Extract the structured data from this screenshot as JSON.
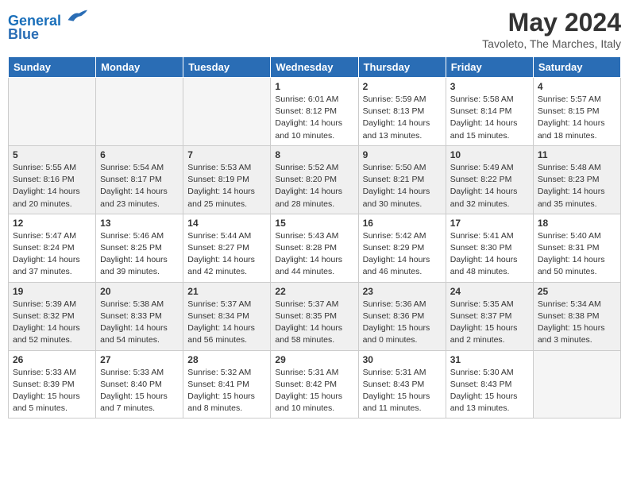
{
  "header": {
    "logo_line1": "General",
    "logo_line2": "Blue",
    "month": "May 2024",
    "location": "Tavoleto, The Marches, Italy"
  },
  "weekdays": [
    "Sunday",
    "Monday",
    "Tuesday",
    "Wednesday",
    "Thursday",
    "Friday",
    "Saturday"
  ],
  "weeks": [
    [
      {
        "day": "",
        "sunrise": "",
        "sunset": "",
        "daylight": ""
      },
      {
        "day": "",
        "sunrise": "",
        "sunset": "",
        "daylight": ""
      },
      {
        "day": "",
        "sunrise": "",
        "sunset": "",
        "daylight": ""
      },
      {
        "day": "1",
        "sunrise": "Sunrise: 6:01 AM",
        "sunset": "Sunset: 8:12 PM",
        "daylight": "Daylight: 14 hours and 10 minutes."
      },
      {
        "day": "2",
        "sunrise": "Sunrise: 5:59 AM",
        "sunset": "Sunset: 8:13 PM",
        "daylight": "Daylight: 14 hours and 13 minutes."
      },
      {
        "day": "3",
        "sunrise": "Sunrise: 5:58 AM",
        "sunset": "Sunset: 8:14 PM",
        "daylight": "Daylight: 14 hours and 15 minutes."
      },
      {
        "day": "4",
        "sunrise": "Sunrise: 5:57 AM",
        "sunset": "Sunset: 8:15 PM",
        "daylight": "Daylight: 14 hours and 18 minutes."
      }
    ],
    [
      {
        "day": "5",
        "sunrise": "Sunrise: 5:55 AM",
        "sunset": "Sunset: 8:16 PM",
        "daylight": "Daylight: 14 hours and 20 minutes."
      },
      {
        "day": "6",
        "sunrise": "Sunrise: 5:54 AM",
        "sunset": "Sunset: 8:17 PM",
        "daylight": "Daylight: 14 hours and 23 minutes."
      },
      {
        "day": "7",
        "sunrise": "Sunrise: 5:53 AM",
        "sunset": "Sunset: 8:19 PM",
        "daylight": "Daylight: 14 hours and 25 minutes."
      },
      {
        "day": "8",
        "sunrise": "Sunrise: 5:52 AM",
        "sunset": "Sunset: 8:20 PM",
        "daylight": "Daylight: 14 hours and 28 minutes."
      },
      {
        "day": "9",
        "sunrise": "Sunrise: 5:50 AM",
        "sunset": "Sunset: 8:21 PM",
        "daylight": "Daylight: 14 hours and 30 minutes."
      },
      {
        "day": "10",
        "sunrise": "Sunrise: 5:49 AM",
        "sunset": "Sunset: 8:22 PM",
        "daylight": "Daylight: 14 hours and 32 minutes."
      },
      {
        "day": "11",
        "sunrise": "Sunrise: 5:48 AM",
        "sunset": "Sunset: 8:23 PM",
        "daylight": "Daylight: 14 hours and 35 minutes."
      }
    ],
    [
      {
        "day": "12",
        "sunrise": "Sunrise: 5:47 AM",
        "sunset": "Sunset: 8:24 PM",
        "daylight": "Daylight: 14 hours and 37 minutes."
      },
      {
        "day": "13",
        "sunrise": "Sunrise: 5:46 AM",
        "sunset": "Sunset: 8:25 PM",
        "daylight": "Daylight: 14 hours and 39 minutes."
      },
      {
        "day": "14",
        "sunrise": "Sunrise: 5:44 AM",
        "sunset": "Sunset: 8:27 PM",
        "daylight": "Daylight: 14 hours and 42 minutes."
      },
      {
        "day": "15",
        "sunrise": "Sunrise: 5:43 AM",
        "sunset": "Sunset: 8:28 PM",
        "daylight": "Daylight: 14 hours and 44 minutes."
      },
      {
        "day": "16",
        "sunrise": "Sunrise: 5:42 AM",
        "sunset": "Sunset: 8:29 PM",
        "daylight": "Daylight: 14 hours and 46 minutes."
      },
      {
        "day": "17",
        "sunrise": "Sunrise: 5:41 AM",
        "sunset": "Sunset: 8:30 PM",
        "daylight": "Daylight: 14 hours and 48 minutes."
      },
      {
        "day": "18",
        "sunrise": "Sunrise: 5:40 AM",
        "sunset": "Sunset: 8:31 PM",
        "daylight": "Daylight: 14 hours and 50 minutes."
      }
    ],
    [
      {
        "day": "19",
        "sunrise": "Sunrise: 5:39 AM",
        "sunset": "Sunset: 8:32 PM",
        "daylight": "Daylight: 14 hours and 52 minutes."
      },
      {
        "day": "20",
        "sunrise": "Sunrise: 5:38 AM",
        "sunset": "Sunset: 8:33 PM",
        "daylight": "Daylight: 14 hours and 54 minutes."
      },
      {
        "day": "21",
        "sunrise": "Sunrise: 5:37 AM",
        "sunset": "Sunset: 8:34 PM",
        "daylight": "Daylight: 14 hours and 56 minutes."
      },
      {
        "day": "22",
        "sunrise": "Sunrise: 5:37 AM",
        "sunset": "Sunset: 8:35 PM",
        "daylight": "Daylight: 14 hours and 58 minutes."
      },
      {
        "day": "23",
        "sunrise": "Sunrise: 5:36 AM",
        "sunset": "Sunset: 8:36 PM",
        "daylight": "Daylight: 15 hours and 0 minutes."
      },
      {
        "day": "24",
        "sunrise": "Sunrise: 5:35 AM",
        "sunset": "Sunset: 8:37 PM",
        "daylight": "Daylight: 15 hours and 2 minutes."
      },
      {
        "day": "25",
        "sunrise": "Sunrise: 5:34 AM",
        "sunset": "Sunset: 8:38 PM",
        "daylight": "Daylight: 15 hours and 3 minutes."
      }
    ],
    [
      {
        "day": "26",
        "sunrise": "Sunrise: 5:33 AM",
        "sunset": "Sunset: 8:39 PM",
        "daylight": "Daylight: 15 hours and 5 minutes."
      },
      {
        "day": "27",
        "sunrise": "Sunrise: 5:33 AM",
        "sunset": "Sunset: 8:40 PM",
        "daylight": "Daylight: 15 hours and 7 minutes."
      },
      {
        "day": "28",
        "sunrise": "Sunrise: 5:32 AM",
        "sunset": "Sunset: 8:41 PM",
        "daylight": "Daylight: 15 hours and 8 minutes."
      },
      {
        "day": "29",
        "sunrise": "Sunrise: 5:31 AM",
        "sunset": "Sunset: 8:42 PM",
        "daylight": "Daylight: 15 hours and 10 minutes."
      },
      {
        "day": "30",
        "sunrise": "Sunrise: 5:31 AM",
        "sunset": "Sunset: 8:43 PM",
        "daylight": "Daylight: 15 hours and 11 minutes."
      },
      {
        "day": "31",
        "sunrise": "Sunrise: 5:30 AM",
        "sunset": "Sunset: 8:43 PM",
        "daylight": "Daylight: 15 hours and 13 minutes."
      },
      {
        "day": "",
        "sunrise": "",
        "sunset": "",
        "daylight": ""
      }
    ]
  ]
}
